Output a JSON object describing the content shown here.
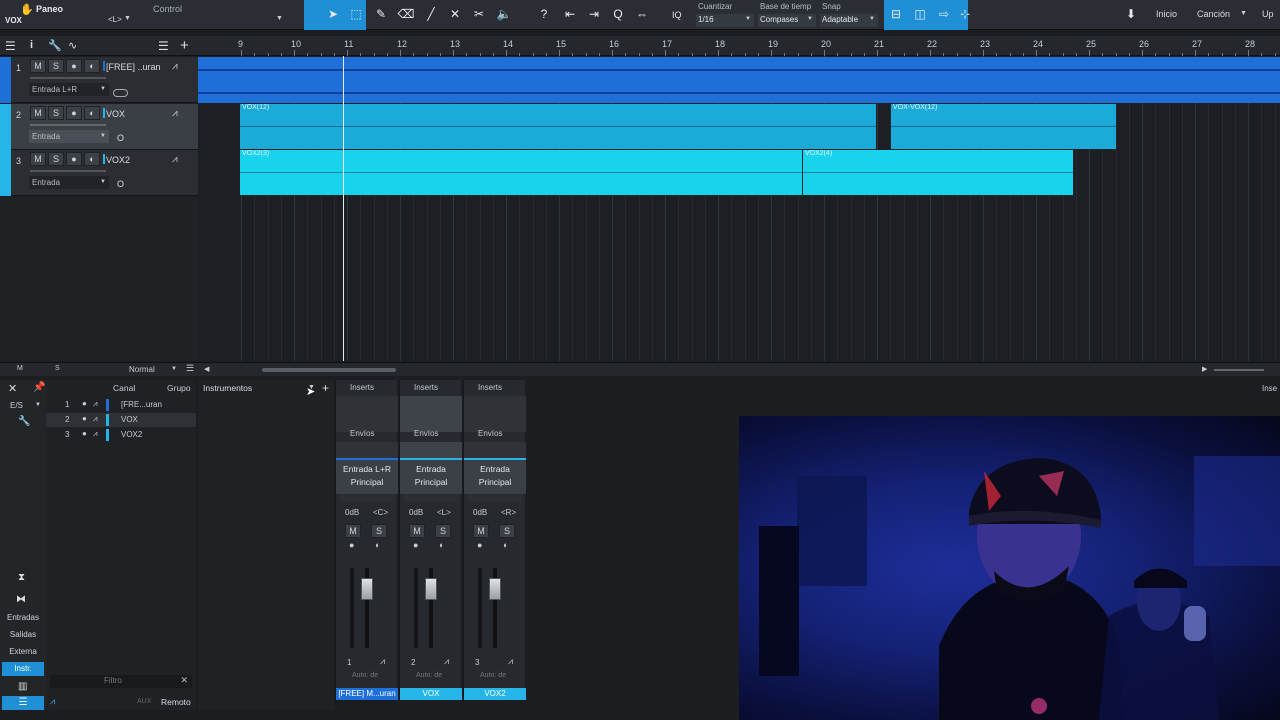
{
  "toolbar": {
    "mode_label": "Paneo",
    "track_label": "VOX",
    "control_label": "Control",
    "position_label": "<L>",
    "quantize_label": "Cuantizar",
    "quantize_value": "1/16",
    "timebase_label": "Base de tiemp",
    "timebase_value": "Compases",
    "snap_label": "Snap",
    "snap_value": "Adaptable",
    "iq_label": "IQ",
    "home_label": "Inicio",
    "song_label": "Canción",
    "extra_label": "Up"
  },
  "ruler": {
    "bars": [
      "9",
      "10",
      "11",
      "12",
      "13",
      "14",
      "15",
      "16",
      "17",
      "18",
      "19",
      "20",
      "21",
      "22",
      "23",
      "24",
      "25",
      "26",
      "27",
      "28"
    ]
  },
  "tracks": [
    {
      "num": "1",
      "name": "[FREE] ..uran",
      "input": "Entrada L+R",
      "color": "#1f6fd8"
    },
    {
      "num": "2",
      "name": "VOX",
      "input": "Entrada",
      "color": "#25b5e8"
    },
    {
      "num": "3",
      "name": "VOX2",
      "input": "Entrada",
      "color": "#25b5e8"
    }
  ],
  "track_buttons": {
    "m": "M",
    "s": "S"
  },
  "clips": {
    "vox_a": "VOX(12)",
    "vox_b": "VOX-VOX(12)",
    "vox2_a": "VOX2(3)",
    "vox2_b": "VOX2(4)"
  },
  "bottombar": {
    "m": "M",
    "s": "S",
    "mode": "Normal"
  },
  "console": {
    "io_label": "E/S",
    "col_channel": "Canal",
    "col_group": "Grupo",
    "instruments_label": "Instrumentos",
    "filter_placeholder": "Filtro",
    "left_buttons": [
      "Entradas",
      "Salidas",
      "Externa",
      "Instr."
    ],
    "bottom_labels": [
      "AUX",
      "Remoto"
    ],
    "right_edge": "Inse",
    "channels": [
      {
        "num": "1",
        "name": "[FRE...uran"
      },
      {
        "num": "2",
        "name": "VOX"
      },
      {
        "num": "3",
        "name": "VOX2"
      }
    ]
  },
  "strips": [
    {
      "inserts": "Inserts",
      "sends": "Envíos",
      "route_in": "Entrada L+R",
      "route_out": "Principal",
      "gain": "0dB",
      "pan": "<C>",
      "m": "M",
      "s": "S",
      "num": "1",
      "auto": "Auto: de",
      "name": "[FREE] M...uran",
      "name_color": "#1f6fd8"
    },
    {
      "inserts": "Inserts",
      "sends": "Envíos",
      "route_in": "Entrada",
      "route_out": "Principal",
      "gain": "0dB",
      "pan": "<L>",
      "m": "M",
      "s": "S",
      "num": "2",
      "auto": "Auto: de",
      "name": "VOX",
      "name_color": "#25b5e8"
    },
    {
      "inserts": "Inserts",
      "sends": "Envíos",
      "route_in": "Entrada",
      "route_out": "Principal",
      "gain": "0dB",
      "pan": "<R>",
      "m": "M",
      "s": "S",
      "num": "3",
      "auto": "Auto: de",
      "name": "VOX2",
      "name_color": "#25b5e8"
    }
  ]
}
